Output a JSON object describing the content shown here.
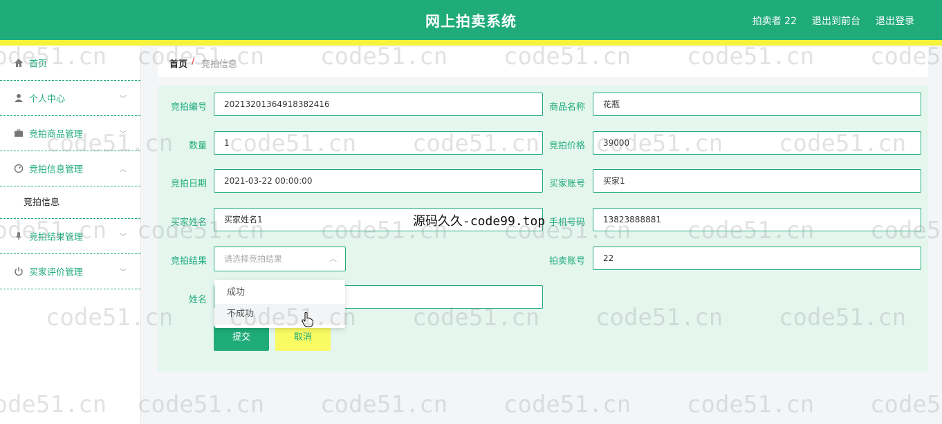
{
  "header": {
    "title": "网上拍卖系统",
    "links": [
      "拍卖者 22",
      "退出到前台",
      "退出登录"
    ]
  },
  "sidebar": {
    "items": [
      {
        "label": "首页",
        "icon": "home-icon",
        "arrow": ""
      },
      {
        "label": "个人中心",
        "icon": "user-icon",
        "arrow": "﹀"
      },
      {
        "label": "竞拍商品管理",
        "icon": "briefcase-icon",
        "arrow": "﹀"
      },
      {
        "label": "竞拍信息管理",
        "icon": "dashboard-icon",
        "arrow": "︿"
      },
      {
        "label": "竞拍结果管理",
        "icon": "microphone-icon",
        "arrow": "﹀"
      },
      {
        "label": "买家评价管理",
        "icon": "power-icon",
        "arrow": "﹀"
      }
    ],
    "submenu": "竞拍信息"
  },
  "breadcrumb": {
    "home": "首页",
    "sep": "/",
    "current": "竞拍信息"
  },
  "form": {
    "auction_no_label": "竞拍编号",
    "auction_no": "20213201364918382416",
    "product_name_label": "商品名称",
    "product_name": "花瓶",
    "quantity_label": "数量",
    "quantity": "1",
    "price_label": "竞拍价格",
    "price": "39000",
    "date_label": "竞拍日期",
    "date": "2021-03-22 00:00:00",
    "buyer_account_label": "买家账号",
    "buyer_account": "买家1",
    "buyer_name_label": "买家姓名",
    "buyer_name": "买家姓名1",
    "phone_label": "手机号码",
    "phone": "13823888881",
    "result_label": "竞拍结果",
    "result_placeholder": "请选择竞拍结果",
    "seller_account_label": "拍卖账号",
    "seller_account": "22",
    "name_label": "姓名",
    "name": "",
    "submit": "提交",
    "cancel": "取消"
  },
  "dropdown": {
    "options": [
      "成功",
      "不成功"
    ]
  },
  "watermark": {
    "text": "code51.cn",
    "overlay": "源码久久-code99.top"
  },
  "colors": {
    "primary": "#1fab7a",
    "accent": "#f4f43a",
    "panel": "#e5f6ef"
  }
}
